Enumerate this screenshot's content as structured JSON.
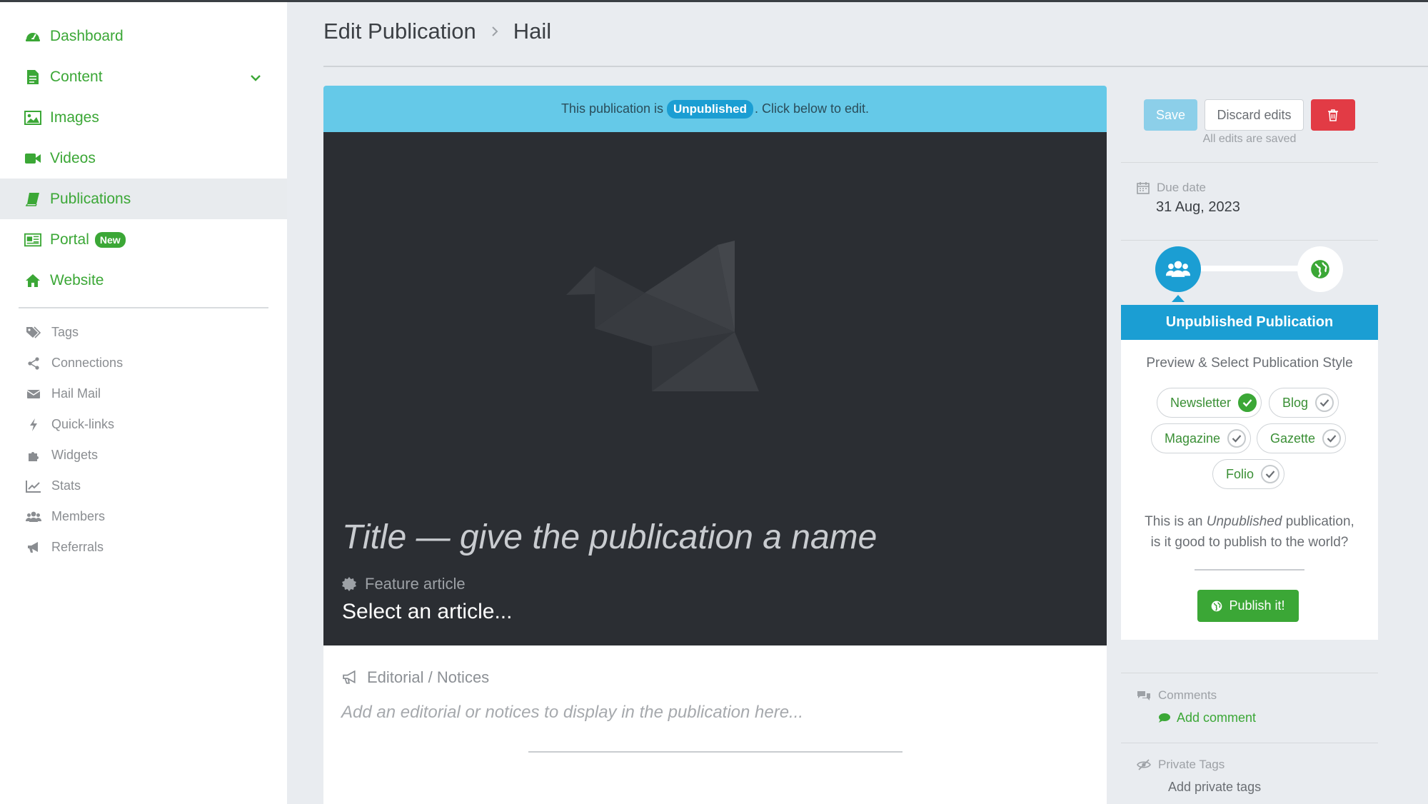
{
  "sidebar": {
    "main_items": [
      {
        "label": "Dashboard",
        "icon": "dashboard-icon"
      },
      {
        "label": "Content",
        "icon": "document-icon"
      },
      {
        "label": "Images",
        "icon": "image-icon"
      },
      {
        "label": "Videos",
        "icon": "video-camera-icon"
      },
      {
        "label": "Publications",
        "icon": "book-icon",
        "active": true
      },
      {
        "label": "Portal",
        "icon": "newspaper-icon",
        "badge": "New"
      },
      {
        "label": "Website",
        "icon": "home-icon"
      }
    ],
    "sub_items": [
      {
        "label": "Tags",
        "icon": "tags-icon"
      },
      {
        "label": "Connections",
        "icon": "share-icon"
      },
      {
        "label": "Hail Mail",
        "icon": "envelope-icon"
      },
      {
        "label": "Quick-links",
        "icon": "bolt-icon"
      },
      {
        "label": "Widgets",
        "icon": "puzzle-icon"
      },
      {
        "label": "Stats",
        "icon": "line-chart-icon"
      },
      {
        "label": "Members",
        "icon": "users-icon"
      },
      {
        "label": "Referrals",
        "icon": "bullhorn-icon"
      }
    ]
  },
  "header": {
    "breadcrumb_parent": "Edit Publication",
    "breadcrumb_current": "Hail"
  },
  "main": {
    "banner_prefix": "This publication is",
    "banner_status": "Unpublished",
    "banner_suffix": ". Click below to edit.",
    "title_placeholder": "Title — give the publication a name",
    "feature_label": "Feature article",
    "feature_select": "Select an article...",
    "editorial_label": "Editorial / Notices",
    "editorial_placeholder": "Add an editorial or notices to display in the publication here..."
  },
  "actions": {
    "save_label": "Save",
    "discard_label": "Discard edits",
    "saved_status": "All edits are saved"
  },
  "details": {
    "due_label": "Due date",
    "due_value": "31 Aug, 2023"
  },
  "status": {
    "heading": "Unpublished Publication",
    "preview_label": "Preview & Select Publication Style",
    "styles": [
      {
        "label": "Newsletter",
        "selected": true
      },
      {
        "label": "Blog",
        "selected": false
      },
      {
        "label": "Magazine",
        "selected": false
      },
      {
        "label": "Gazette",
        "selected": false
      },
      {
        "label": "Folio",
        "selected": false
      }
    ],
    "message_prefix": "This is an",
    "message_status": "Unpublished",
    "message_line1_suffix": "publication,",
    "message_line2": "is it good to publish to the world?",
    "publish_label": "Publish it!"
  },
  "comments": {
    "label": "Comments",
    "add_label": "Add comment"
  },
  "private_tags": {
    "label": "Private Tags",
    "add_label": "Add private tags"
  },
  "colors": {
    "brand_green": "#3ba736",
    "accent_blue": "#1b9ed3",
    "banner_blue": "#65c9e8",
    "danger_red": "#e23b45",
    "hero_dark": "#2b2e33"
  }
}
